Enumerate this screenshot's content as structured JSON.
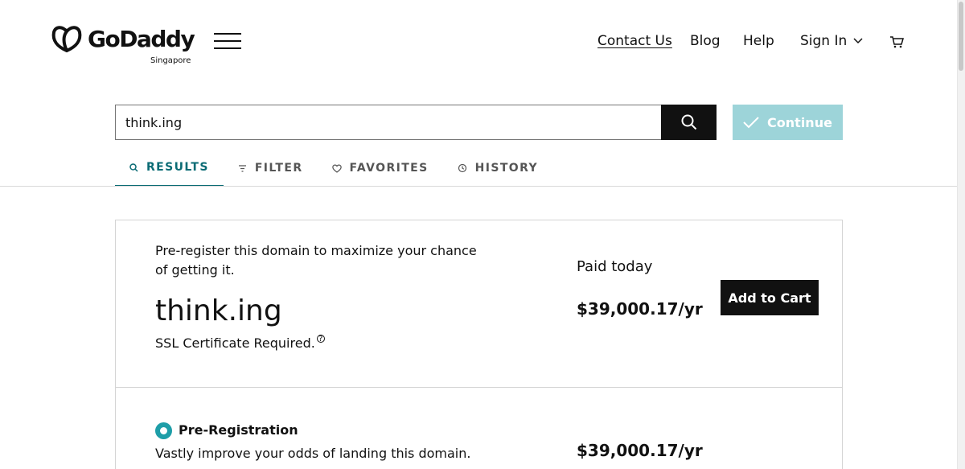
{
  "brand": {
    "name": "GoDaddy",
    "region": "Singapore"
  },
  "nav": {
    "contact": "Contact Us",
    "blog": "Blog",
    "help": "Help",
    "signin": "Sign In"
  },
  "search": {
    "value": "think.ing",
    "continue_label": "Continue"
  },
  "tabs": [
    {
      "label": "RESULTS",
      "icon": "search-icon",
      "active": true
    },
    {
      "label": "FILTER",
      "icon": "filter-icon",
      "active": false
    },
    {
      "label": "FAVORITES",
      "icon": "heart-icon",
      "active": false
    },
    {
      "label": "HISTORY",
      "icon": "history-icon",
      "active": false
    }
  ],
  "result": {
    "message": "Pre-register this domain to maximize your chance of getting it.",
    "domain": "think.ing",
    "ssl_note": "SSL Certificate Required.",
    "paid_label": "Paid today",
    "price": "$39,000.17/yr",
    "cta": "Add to Cart"
  },
  "option": {
    "title": "Pre-Registration",
    "description": "Vastly improve your odds of landing this domain.",
    "price": "$39,000.17/yr"
  },
  "colors": {
    "accent": "#0a6b74",
    "continue_bg": "#9dd4d9",
    "radio": "#1e9ea8"
  }
}
